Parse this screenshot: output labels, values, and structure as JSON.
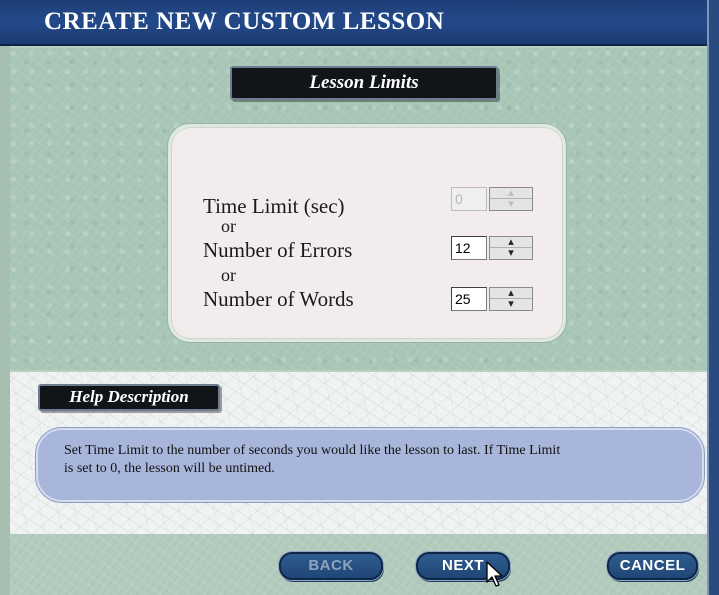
{
  "window": {
    "title": "CREATE NEW CUSTOM LESSON"
  },
  "lesson_limits": {
    "heading": "Lesson Limits",
    "fields": [
      {
        "label": "Time Limit (sec)",
        "value": "0",
        "enabled": false
      },
      {
        "label": "Number of Errors",
        "value": "12",
        "enabled": true
      },
      {
        "label": "Number of Words",
        "value": "25",
        "enabled": true
      }
    ],
    "separator": "or"
  },
  "help": {
    "heading": "Help Description",
    "line1": "Set Time Limit to the number of seconds you would like the lesson to last. If Time Limit",
    "line2": "is set to 0, the lesson will be untimed."
  },
  "buttons": {
    "back": "BACK",
    "next": "NEXT",
    "cancel": "CANCEL"
  },
  "colors": {
    "title_bar": "#23498a",
    "panel_green": "#a9c7b7",
    "help_box": "#a7b6da",
    "button": "#1f4676"
  },
  "icons": [
    "mouse-pointer-icon",
    "spin-up-icon",
    "spin-down-icon"
  ]
}
